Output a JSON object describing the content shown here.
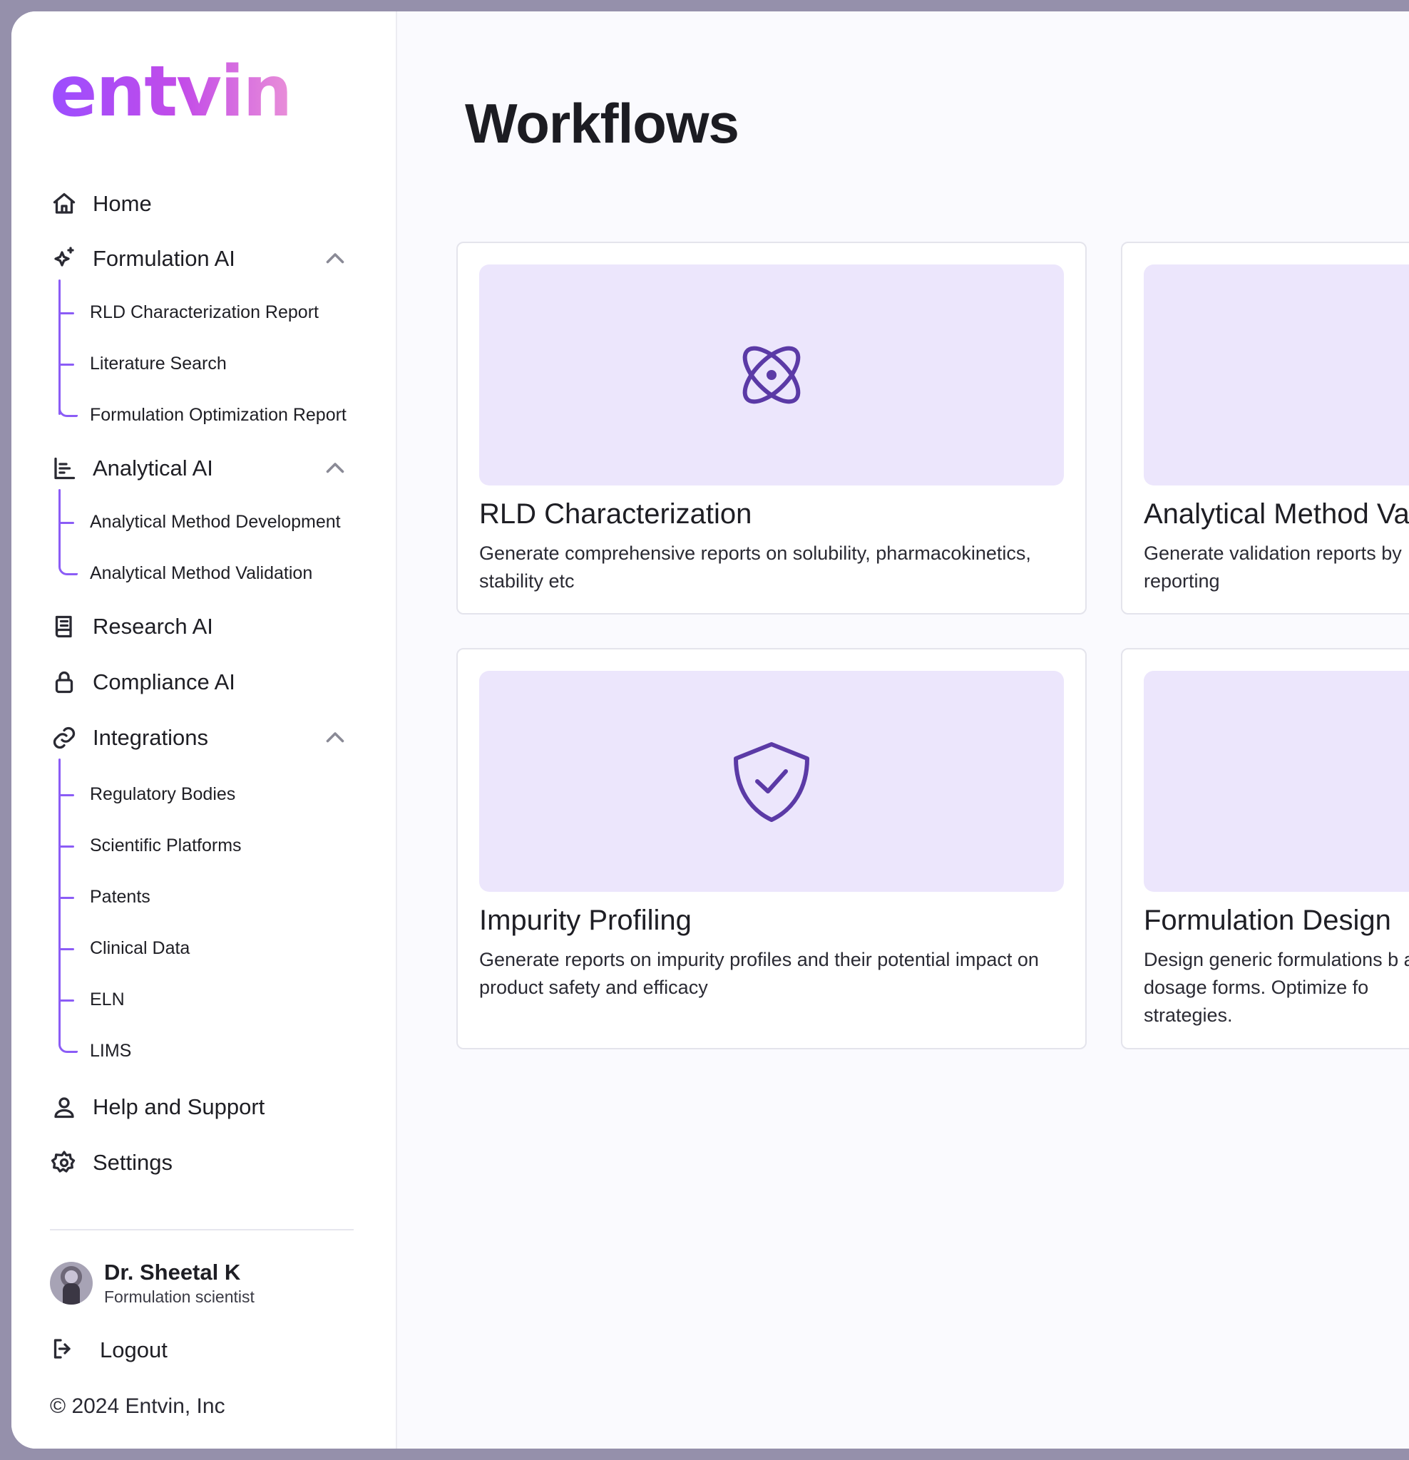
{
  "sidebar": {
    "logo": "entvin",
    "nav": {
      "home": "Home",
      "formulation_ai": "Formulation AI",
      "formulation_sub": [
        "RLD Characterization Report",
        "Literature Search",
        "Formulation Optimization Report"
      ],
      "analytical_ai": "Analytical AI",
      "analytical_sub": [
        "Analytical Method Development",
        "Analytical Method Validation"
      ],
      "research_ai": "Research AI",
      "compliance_ai": "Compliance AI",
      "integrations": "Integrations",
      "integrations_sub": [
        "Regulatory Bodies",
        "Scientific Platforms",
        "Patents",
        "Clinical Data",
        "ELN",
        "LIMS"
      ],
      "help": "Help and Support",
      "settings": "Settings"
    },
    "profile": {
      "name": "Dr. Sheetal K",
      "role": "Formulation scientist"
    },
    "logout": "Logout",
    "copyright": "© 2024 Entvin, Inc"
  },
  "main": {
    "title": "Workflows",
    "cards": [
      {
        "title": "RLD Characterization",
        "desc": "Generate comprehensive reports on solubility, pharmacokinetics, stability etc",
        "icon": "atom-icon"
      },
      {
        "title": "Analytical Method Va",
        "desc": "Generate validation reports by reporting",
        "icon": "flask-icon"
      },
      {
        "title": "Impurity Profiling",
        "desc": "Generate reports on impurity profiles and their potential impact on product safety and efficacy",
        "icon": "shield-check-icon"
      },
      {
        "title": "Formulation Design",
        "desc": "Design generic formulations b and dosage forms. Optimize fo strategies.",
        "icon": "beaker-icon"
      }
    ]
  },
  "colors": {
    "accent": "#8b5cf6",
    "banner": "#ece6fc",
    "icon": "#5b3aa6",
    "frame": "#9590ab"
  }
}
